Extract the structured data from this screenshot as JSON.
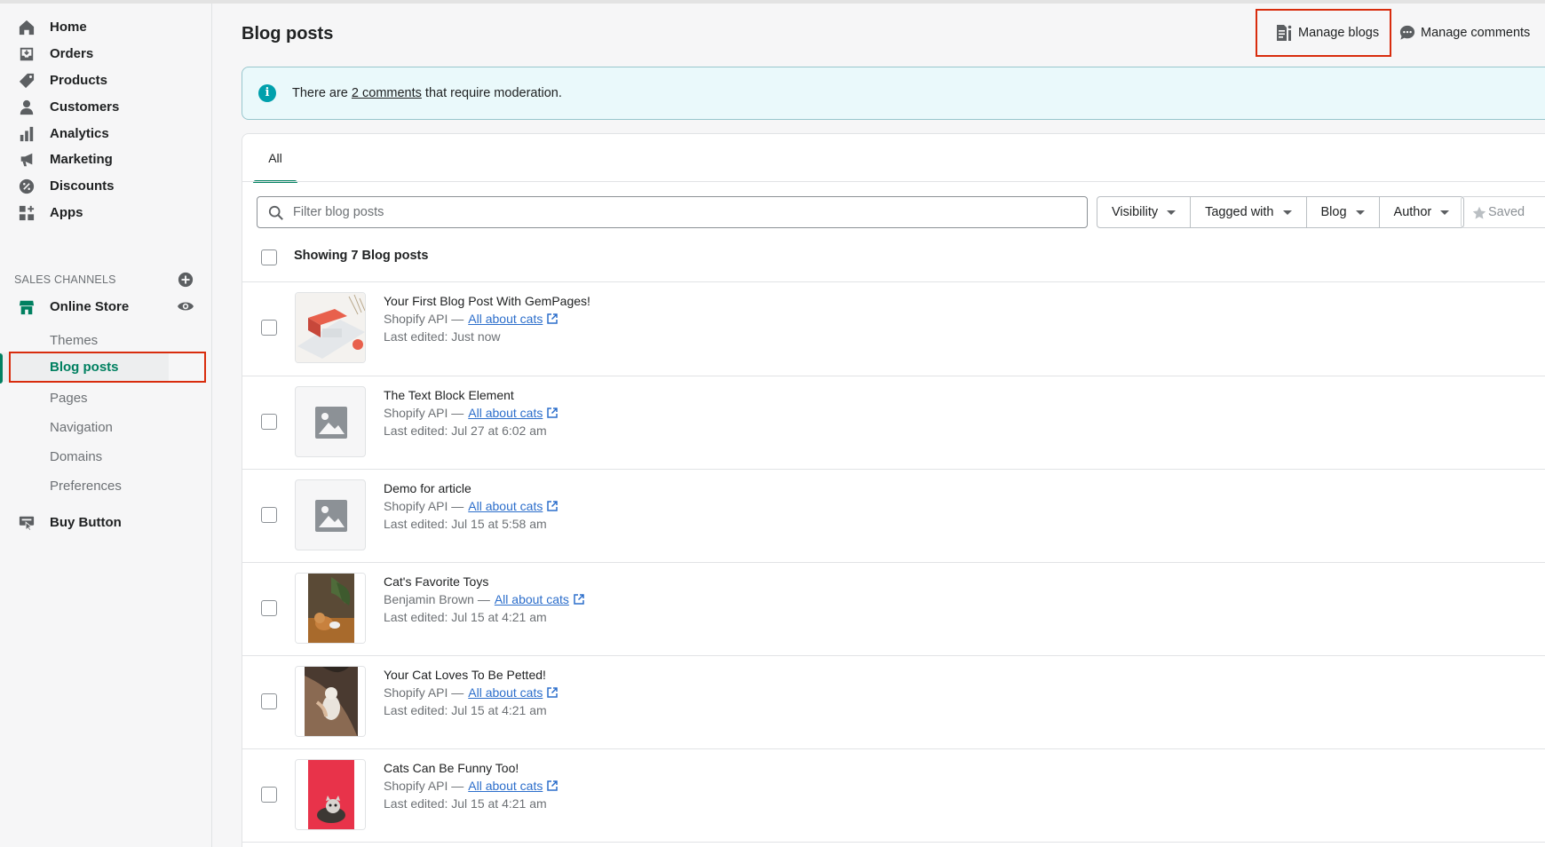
{
  "sidebar": {
    "items": [
      {
        "label": "Home",
        "icon": "home-icon"
      },
      {
        "label": "Orders",
        "icon": "orders-icon"
      },
      {
        "label": "Products",
        "icon": "tag-icon"
      },
      {
        "label": "Customers",
        "icon": "person-icon"
      },
      {
        "label": "Analytics",
        "icon": "bar-chart-icon"
      },
      {
        "label": "Marketing",
        "icon": "megaphone-icon"
      },
      {
        "label": "Discounts",
        "icon": "discount-icon"
      },
      {
        "label": "Apps",
        "icon": "apps-icon"
      }
    ],
    "sales_channels_title": "SALES CHANNELS",
    "online_store": {
      "label": "Online Store",
      "icon": "store-icon"
    },
    "sub_items": [
      {
        "label": "Themes"
      },
      {
        "label": "Blog posts"
      },
      {
        "label": "Pages"
      },
      {
        "label": "Navigation"
      },
      {
        "label": "Domains"
      },
      {
        "label": "Preferences"
      }
    ],
    "buy_button": {
      "label": "Buy Button",
      "icon": "buy-button-icon"
    }
  },
  "header": {
    "title": "Blog posts",
    "manage_blogs": "Manage blogs",
    "manage_comments": "Manage comments"
  },
  "banner": {
    "prefix": "There are ",
    "link": "2 comments",
    "suffix": " that require moderation."
  },
  "tabs": [
    {
      "label": "All"
    }
  ],
  "filter": {
    "placeholder": "Filter blog posts",
    "buttons": [
      "Visibility",
      "Tagged with",
      "Blog",
      "Author"
    ],
    "saved": "Saved"
  },
  "list": {
    "showing": "Showing 7 Blog posts",
    "rows": [
      {
        "title": "Your First Blog Post With GemPages!",
        "author": "Shopify API —",
        "blog": "All about cats",
        "edited": "Last edited: Just now"
      },
      {
        "title": "The Text Block Element",
        "author": "Shopify API —",
        "blog": "All about cats",
        "edited": "Last edited: Jul 27 at 6:02 am"
      },
      {
        "title": "Demo for article",
        "author": "Shopify API —",
        "blog": "All about cats",
        "edited": "Last edited: Jul 15 at 5:58 am"
      },
      {
        "title": "Cat's Favorite Toys",
        "author": "Benjamin Brown —",
        "blog": "All about cats",
        "edited": "Last edited: Jul 15 at 4:21 am"
      },
      {
        "title": "Your Cat Loves To Be Petted!",
        "author": "Shopify API —",
        "blog": "All about cats",
        "edited": "Last edited: Jul 15 at 4:21 am"
      },
      {
        "title": "Cats Can Be Funny Too!",
        "author": "Shopify API —",
        "blog": "All about cats",
        "edited": "Last edited: Jul 15 at 4:21 am"
      }
    ]
  },
  "colors": {
    "accent": "#008060",
    "link": "#2c6ecb",
    "highlight_box": "#d82c0d",
    "banner_bg": "#eaf9fb"
  }
}
